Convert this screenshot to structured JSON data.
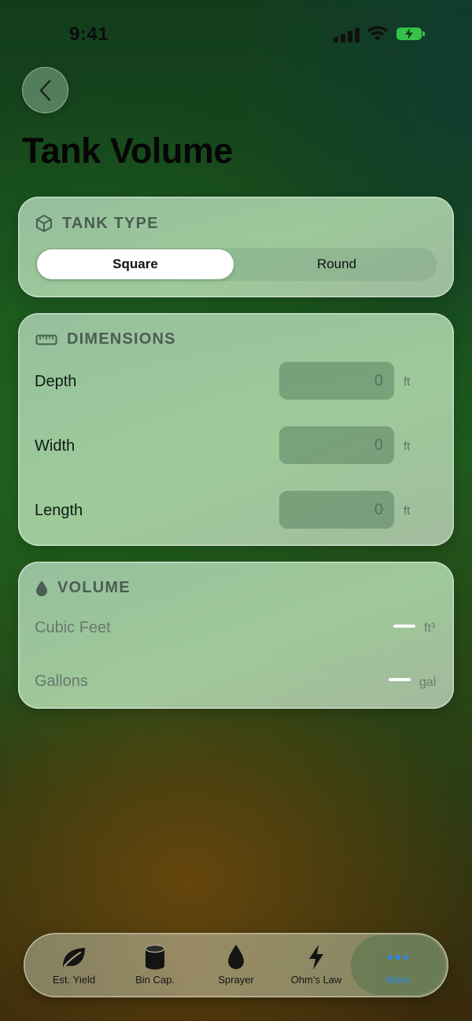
{
  "status_bar": {
    "time": "9:41"
  },
  "page": {
    "title": "Tank Volume"
  },
  "tank_type": {
    "header": "TANK TYPE",
    "options": [
      "Square",
      "Round"
    ],
    "selected": "Square"
  },
  "dimensions": {
    "header": "DIMENSIONS",
    "rows": [
      {
        "label": "Depth",
        "placeholder": "0",
        "value": "",
        "unit": "ft"
      },
      {
        "label": "Width",
        "placeholder": "0",
        "value": "",
        "unit": "ft"
      },
      {
        "label": "Length",
        "placeholder": "0",
        "value": "",
        "unit": "ft"
      }
    ]
  },
  "volume": {
    "header": "VOLUME",
    "rows": [
      {
        "label": "Cubic Feet",
        "unit": "ft³"
      },
      {
        "label": "Gallons",
        "unit": "gal"
      }
    ]
  },
  "tab_bar": {
    "items": [
      {
        "label": "Est. Yield",
        "icon": "leaf-icon"
      },
      {
        "label": "Bin Cap.",
        "icon": "cylinder-icon"
      },
      {
        "label": "Sprayer",
        "icon": "drop-icon"
      },
      {
        "label": "Ohm's Law",
        "icon": "bolt-icon"
      },
      {
        "label": "More",
        "icon": "ellipsis-icon"
      }
    ],
    "selected": "More"
  },
  "colors": {
    "accent": "#2f86e8",
    "battery": "#36c24a"
  }
}
